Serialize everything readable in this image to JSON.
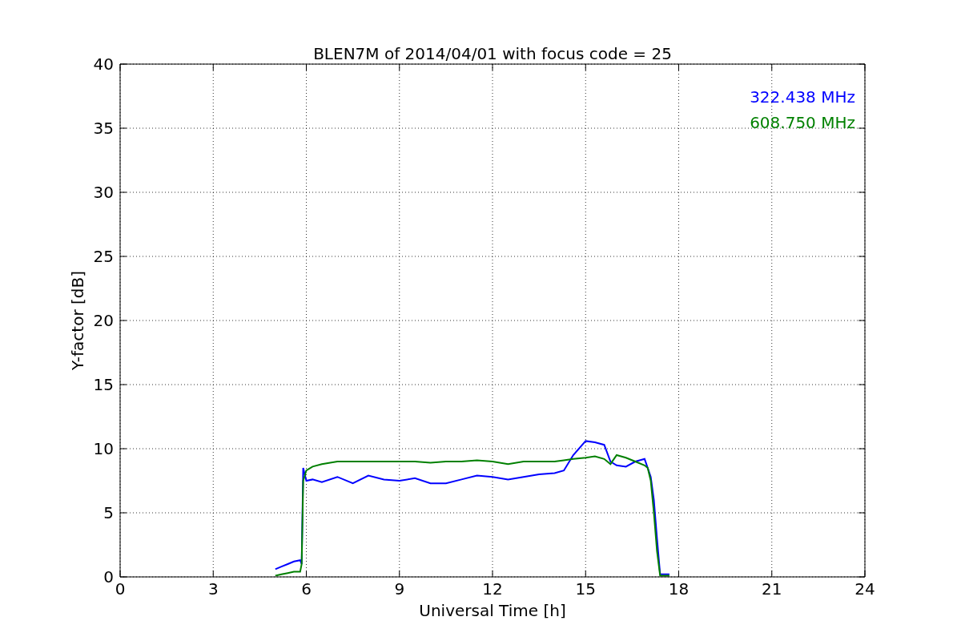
{
  "figure": {
    "chart_data": {
      "type": "line",
      "title": "BLEN7M of 2014/04/01 with focus code = 25",
      "xlabel": "Universal Time [h]",
      "ylabel": "Y-factor [dB]",
      "x": [
        5.0,
        5.2,
        5.4,
        5.6,
        5.8,
        5.85,
        5.9,
        6.0,
        6.2,
        6.5,
        7,
        7.5,
        8,
        8.5,
        9,
        9.5,
        10,
        10.5,
        11,
        11.5,
        12,
        12.5,
        13,
        13.5,
        14,
        14.3,
        14.6,
        15,
        15.3,
        15.6,
        15.8,
        16,
        16.3,
        16.6,
        16.9,
        17.0,
        17.1,
        17.2,
        17.3,
        17.4,
        17.5,
        17.7
      ],
      "series": [
        {
          "name": "322.438 MHz",
          "color": "#0000ff",
          "values": [
            0.6,
            0.8,
            1.0,
            1.2,
            1.3,
            1.0,
            8.5,
            7.5,
            7.6,
            7.4,
            7.8,
            7.3,
            7.9,
            7.6,
            7.5,
            7.7,
            7.3,
            7.3,
            7.6,
            7.9,
            7.8,
            7.6,
            7.8,
            8.0,
            8.1,
            8.3,
            9.5,
            10.6,
            10.5,
            10.3,
            9,
            8.7,
            8.6,
            9.0,
            9.2,
            8.5,
            7.8,
            6.0,
            3,
            0.2,
            0.2,
            0.2
          ]
        },
        {
          "name": "608.750 MHz",
          "color": "#008000",
          "values": [
            0.1,
            0.2,
            0.3,
            0.4,
            0.4,
            1,
            7.5,
            8.3,
            8.6,
            8.8,
            9.0,
            9.0,
            9.0,
            9.0,
            9.0,
            9.0,
            8.9,
            9.0,
            9.0,
            9.1,
            9.0,
            8.8,
            9.0,
            9.0,
            9.0,
            9.1,
            9.2,
            9.3,
            9.4,
            9.2,
            8.8,
            9.5,
            9.3,
            9.0,
            8.7,
            8.5,
            7.5,
            5,
            2,
            0.1,
            0.1,
            0.1
          ]
        }
      ],
      "xlim": [
        0,
        24
      ],
      "ylim": [
        0,
        40
      ],
      "xticks": [
        0,
        3,
        6,
        9,
        12,
        15,
        18,
        21,
        24
      ],
      "yticks": [
        0,
        5,
        10,
        15,
        20,
        25,
        30,
        35,
        40
      ],
      "grid": true
    }
  }
}
